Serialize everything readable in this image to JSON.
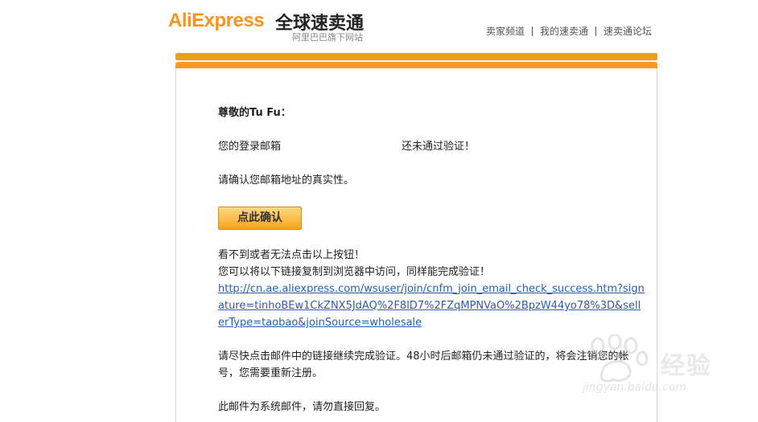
{
  "header": {
    "logo_brand": "AliExpress",
    "logo_cn": "全球速卖通",
    "logo_sub": "阿里巴巴旗下网站",
    "nav": [
      "卖家频道",
      "我的速卖通",
      "速卖通论坛"
    ]
  },
  "email": {
    "greeting": "尊敬的Tu Fu：",
    "login_prefix": "您的登录邮箱",
    "login_suffix": "还未通过验证！",
    "confirm_text": "请确认您邮箱地址的真实性。",
    "confirm_button": "点此确认",
    "alt_heading": "看不到或者无法点击以上按钮！",
    "alt_instruction": "您可以将以下链接复制到浏览器中访问，同样能完成验证！",
    "link": "http://cn.ae.aliexpress.com/wsuser/join/cnfm_join_email_check_success.htm?signature=tinhoBEw1CkZNX5JdAQ%2F8lD7%2FZqMPNVaO%2BpzW44yo78%3D&sellerType=taobao&joinSource=wholesale",
    "reminder": "请尽快点击邮件中的链接继续完成验证。48小时后邮箱仍未通过验证的，将会注销您的帐号，您需要重新注册。",
    "footer_note": "此邮件为系统邮件，请勿直接回复。"
  },
  "watermark": {
    "cn": "经验",
    "site": "jingyan.baidu.com",
    "icon": "baidu-paw-icon"
  },
  "colors": {
    "accent_orange": "#f79a1e",
    "link_blue": "#2a5db0"
  }
}
